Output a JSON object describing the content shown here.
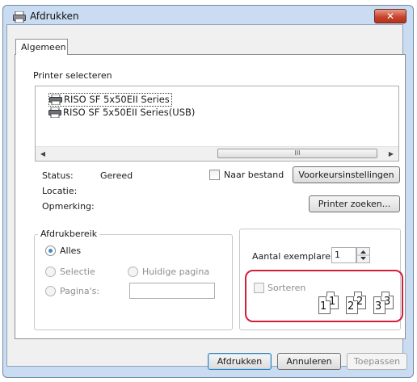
{
  "window": {
    "title": "Afdrukken"
  },
  "tabs": [
    {
      "label": "Algemeen"
    }
  ],
  "printer_select": {
    "group_label": "Printer selecteren",
    "printers": [
      "RISO SF 5x50EII Series",
      "RISO SF 5x50EII Series(USB)"
    ],
    "scroll_grip": "III"
  },
  "status": {
    "status_label": "Status:",
    "status_value": "Gereed",
    "location_label": "Locatie:",
    "location_value": "",
    "comment_label": "Opmerking:",
    "comment_value": "",
    "print_to_file_label": "Naar bestand",
    "preferences_button": "Voorkeursinstellingen",
    "find_printer_button": "Printer zoeken..."
  },
  "print_range": {
    "group_label": "Afdrukbereik",
    "all_label": "Alles",
    "selection_label": "Selectie",
    "current_page_label": "Huidige pagina",
    "pages_label": "Pagina's:",
    "pages_value": ""
  },
  "copies": {
    "count_label": "Aantal exemplaren:",
    "count_value": "1",
    "collate_label": "Sorteren",
    "page_numbers": [
      "1",
      "1",
      "2",
      "2",
      "3",
      "3"
    ]
  },
  "footer": {
    "print_button": "Afdrukken",
    "cancel_button": "Annuleren",
    "apply_button": "Toepassen"
  },
  "colors": {
    "highlight_box": "#d0203a",
    "title_bar": "#c9dcf1",
    "close_button": "#c9452d"
  }
}
